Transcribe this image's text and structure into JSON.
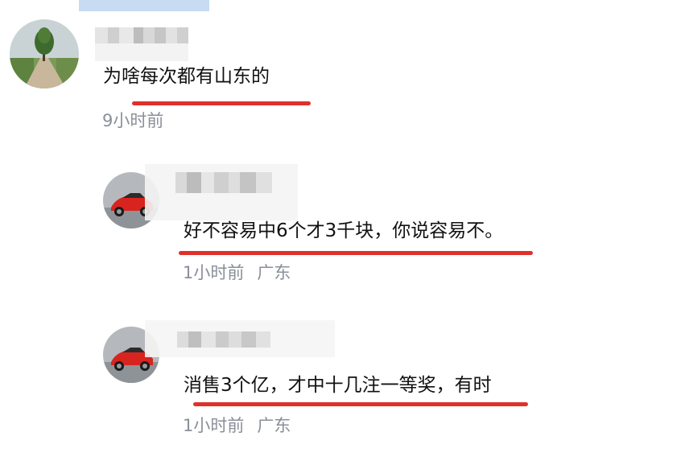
{
  "comments": [
    {
      "text": "为啥每次都有山东的",
      "time": "9小时前",
      "location": ""
    },
    {
      "text": "好不容易中6个才3千块，你说容易不。",
      "time": "1小时前",
      "location": "广东"
    },
    {
      "text": "消售3个亿，才中十几注一等奖，有时",
      "time": "1小时前",
      "location": "广东"
    }
  ],
  "colors": {
    "underline": "#e0302a",
    "meta_text": "#8a8f99"
  },
  "icons": {
    "avatar_1": "tree-road-photo",
    "avatar_2": "red-sports-car-photo",
    "avatar_3": "red-sports-car-photo"
  }
}
